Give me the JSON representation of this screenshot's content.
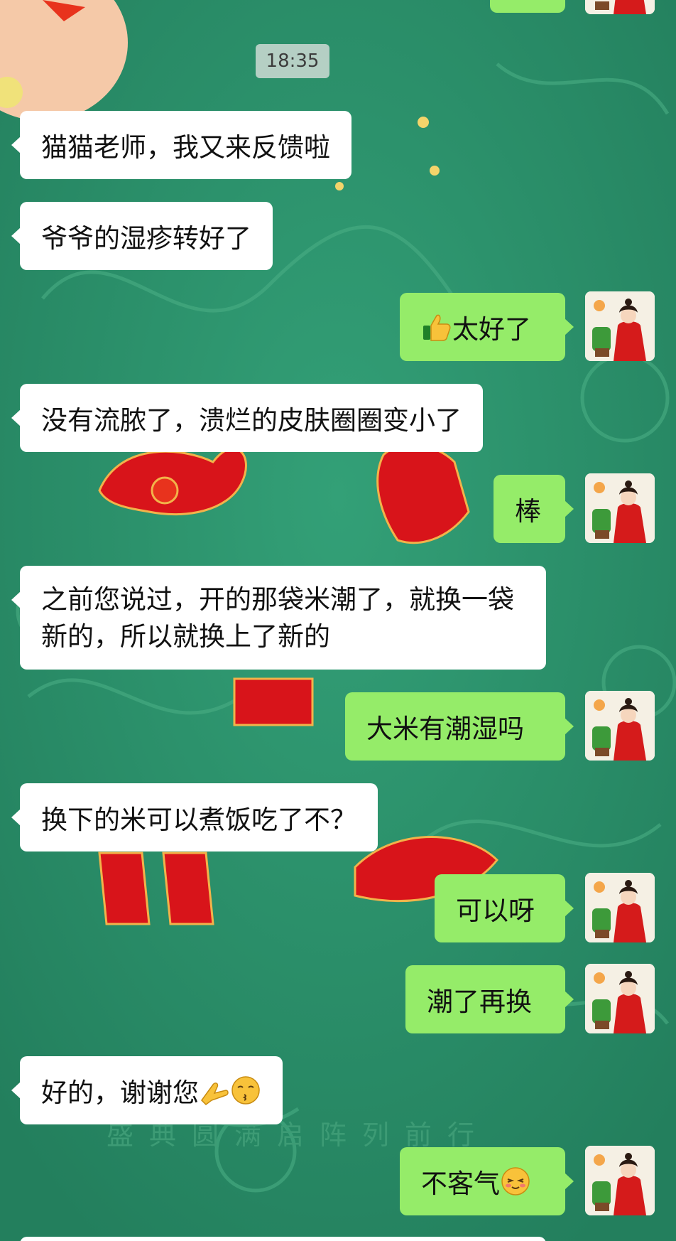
{
  "chat": {
    "timestamp": "18:35",
    "messages": [
      {
        "side": "in",
        "text": "猫猫老师，我又来反馈啦"
      },
      {
        "side": "in",
        "text": "爷爷的湿疹转好了"
      },
      {
        "side": "out",
        "emoji": "thumbs-up-emoji",
        "text": "太好了"
      },
      {
        "side": "in",
        "text": "没有流脓了，溃烂的皮肤圈圈变小了"
      },
      {
        "side": "out",
        "text": "棒"
      },
      {
        "side": "in",
        "text": "之前您说过，开的那袋米潮了，就换一袋新的，所以就换上了新的"
      },
      {
        "side": "out",
        "text": "大米有潮湿吗"
      },
      {
        "side": "in",
        "text": "换下的米可以煮饭吃了不？"
      },
      {
        "side": "out",
        "text": "可以呀"
      },
      {
        "side": "out",
        "text": "潮了再换"
      },
      {
        "side": "in",
        "text": "好的，谢谢您",
        "emoji": [
          "praying-hands-emoji",
          "kissing-face-emoji"
        ]
      },
      {
        "side": "out",
        "text": "不客气",
        "emoji": "smiling-blush-emoji"
      }
    ]
  },
  "colors": {
    "background": "#2a8f6a",
    "incoming_bubble": "#ffffff",
    "outgoing_bubble": "#95ec69",
    "background_art_red": "#d8141a"
  },
  "background_text": "盛典圆满启阵列前行"
}
